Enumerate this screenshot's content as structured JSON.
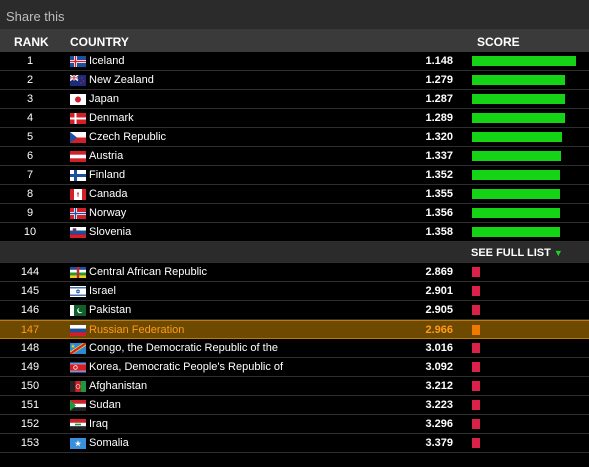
{
  "share_label": "Share this",
  "headers": {
    "rank": "RANK",
    "country": "COUNTRY",
    "score": "SCORE"
  },
  "see_full_list": "SEE FULL LIST",
  "colors": {
    "good": "#15d415",
    "bad": "#d9214a",
    "highlight_bar": "#f07a00",
    "highlight_text": "#ff9a1a"
  },
  "max_score": 1.148,
  "top": [
    {
      "rank": "1",
      "country": "Iceland",
      "score": "1.148",
      "flag": "iceland-flag-icon"
    },
    {
      "rank": "2",
      "country": "New Zealand",
      "score": "1.279",
      "flag": "new-zealand-flag-icon"
    },
    {
      "rank": "3",
      "country": "Japan",
      "score": "1.287",
      "flag": "japan-flag-icon"
    },
    {
      "rank": "4",
      "country": "Denmark",
      "score": "1.289",
      "flag": "denmark-flag-icon"
    },
    {
      "rank": "5",
      "country": "Czech Republic",
      "score": "1.320",
      "flag": "czech-republic-flag-icon"
    },
    {
      "rank": "6",
      "country": "Austria",
      "score": "1.337",
      "flag": "austria-flag-icon"
    },
    {
      "rank": "7",
      "country": "Finland",
      "score": "1.352",
      "flag": "finland-flag-icon"
    },
    {
      "rank": "8",
      "country": "Canada",
      "score": "1.355",
      "flag": "canada-flag-icon"
    },
    {
      "rank": "9",
      "country": "Norway",
      "score": "1.356",
      "flag": "norway-flag-icon"
    },
    {
      "rank": "10",
      "country": "Slovenia",
      "score": "1.358",
      "flag": "slovenia-flag-icon"
    }
  ],
  "bottom": [
    {
      "rank": "144",
      "country": "Central African Republic",
      "score": "2.869",
      "flag": "central-african-republic-flag-icon"
    },
    {
      "rank": "145",
      "country": "Israel",
      "score": "2.901",
      "flag": "israel-flag-icon"
    },
    {
      "rank": "146",
      "country": "Pakistan",
      "score": "2.905",
      "flag": "pakistan-flag-icon"
    },
    {
      "rank": "147",
      "country": "Russian Federation",
      "score": "2.966",
      "flag": "russia-flag-icon",
      "highlight": true
    },
    {
      "rank": "148",
      "country": "Congo, the Democratic Republic of the",
      "score": "3.016",
      "flag": "dr-congo-flag-icon"
    },
    {
      "rank": "149",
      "country": "Korea, Democratic People's Republic of",
      "score": "3.092",
      "flag": "north-korea-flag-icon"
    },
    {
      "rank": "150",
      "country": "Afghanistan",
      "score": "3.212",
      "flag": "afghanistan-flag-icon"
    },
    {
      "rank": "151",
      "country": "Sudan",
      "score": "3.223",
      "flag": "sudan-flag-icon"
    },
    {
      "rank": "152",
      "country": "Iraq",
      "score": "3.296",
      "flag": "iraq-flag-icon"
    },
    {
      "rank": "153",
      "country": "Somalia",
      "score": "3.379",
      "flag": "somalia-flag-icon"
    }
  ]
}
